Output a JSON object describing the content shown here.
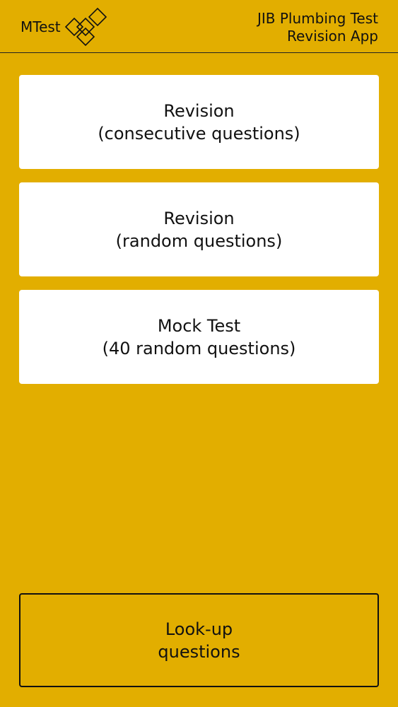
{
  "header": {
    "logo_text": "MTest",
    "logo_icon": "diamond-grid-icon",
    "title_line1": "JIB Plumbing Test",
    "title_line2": "Revision App"
  },
  "menu": {
    "items": [
      {
        "line1": "Revision",
        "line2": "(consecutive questions)"
      },
      {
        "line1": "Revision",
        "line2": "(random questions)"
      },
      {
        "line1": "Mock Test",
        "line2": "(40 random questions)"
      }
    ]
  },
  "footer": {
    "lookup_line1": "Look-up",
    "lookup_line2": "questions"
  },
  "colors": {
    "background": "#E2AE00",
    "card": "#FFFFFF",
    "text": "#111111"
  }
}
